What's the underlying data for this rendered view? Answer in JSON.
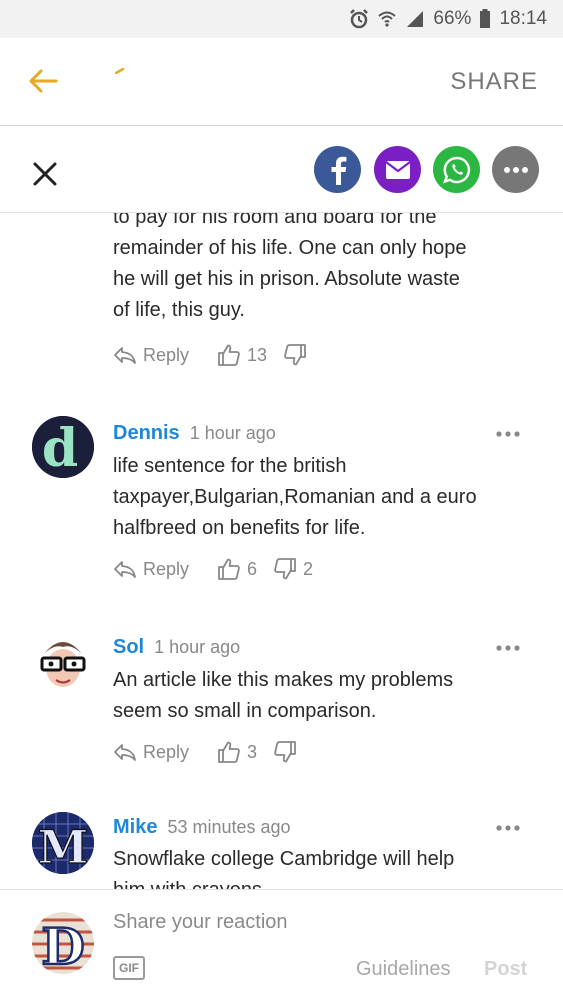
{
  "status_bar": {
    "battery": "66%",
    "time": "18:14",
    "icons": [
      "alarm-icon",
      "wifi-icon",
      "signal-icon",
      "battery-icon"
    ]
  },
  "header": {
    "share_label": "SHARE",
    "back_icon": "arrow-left-icon",
    "accent_color": "#e9a823"
  },
  "share_bar": {
    "close_icon": "close-icon",
    "buttons": [
      {
        "name": "facebook",
        "icon": "facebook-icon",
        "color": "#3b5998"
      },
      {
        "name": "email",
        "icon": "mail-icon",
        "color": "#7b1fc4"
      },
      {
        "name": "whatsapp",
        "icon": "whatsapp-icon",
        "color": "#2bb741"
      },
      {
        "name": "more",
        "icon": "more-icon",
        "color": "#777777"
      }
    ]
  },
  "partial_comment": {
    "lines": [
      "to pay for his room and board for the",
      "remainder of his life. One can only hope",
      "he will get his in prison. Absolute waste",
      "of life, this guy."
    ],
    "reply_label": "Reply",
    "likes": "13",
    "dislikes": ""
  },
  "comments": [
    {
      "author": "Dennis",
      "time": "1 hour ago",
      "lines": [
        "life sentence for the british",
        "taxpayer,Bulgarian,Romanian and a euro",
        "halfbreed on benefits for life."
      ],
      "reply_label": "Reply",
      "likes": "6",
      "dislikes": "2",
      "avatar_letter": "d"
    },
    {
      "author": "Sol",
      "time": "1 hour ago",
      "lines": [
        "An article like this makes my problems",
        "seem so small in comparison."
      ],
      "reply_label": "Reply",
      "likes": "3",
      "dislikes": ""
    },
    {
      "author": "Mike",
      "time": "53 minutes ago",
      "lines": [
        "Snowflake college Cambridge will help",
        "him with crayons"
      ],
      "avatar_letter": "M"
    }
  ],
  "composer": {
    "placeholder": "Share your reaction",
    "gif_label": "GIF",
    "guidelines_label": "Guidelines",
    "post_label": "Post",
    "avatar_letter": "D"
  }
}
